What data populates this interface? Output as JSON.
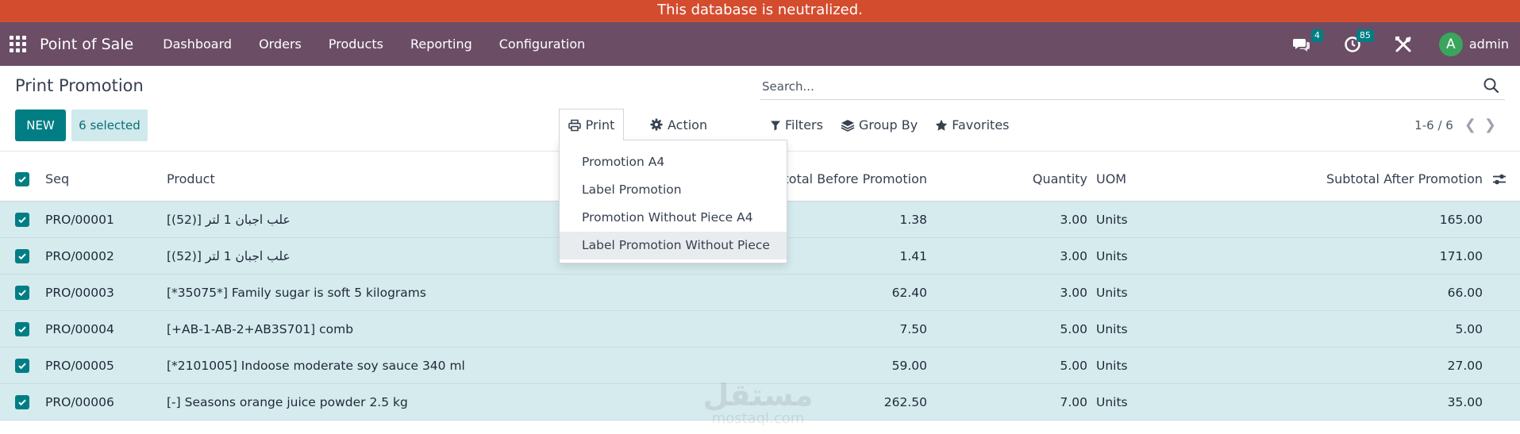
{
  "banner": {
    "text": "This database is neutralized."
  },
  "navbar": {
    "brand": "Point of Sale",
    "menu": [
      "Dashboard",
      "Orders",
      "Products",
      "Reporting",
      "Configuration"
    ],
    "messages_count": "4",
    "activities_count": "85",
    "user_initial": "A",
    "user_name": "admin"
  },
  "page": {
    "title": "Print Promotion"
  },
  "toolbar": {
    "new_label": "NEW",
    "selected_label": "6 selected",
    "print_label": "Print",
    "action_label": "Action"
  },
  "search": {
    "placeholder": "Search..."
  },
  "filters": {
    "filters_label": "Filters",
    "group_by_label": "Group By",
    "favorites_label": "Favorites"
  },
  "pager": {
    "text": "1-6 / 6"
  },
  "print_menu": {
    "items": [
      "Promotion A4",
      "Label Promotion",
      "Promotion Without Piece A4",
      "Label Promotion Without Piece"
    ]
  },
  "table": {
    "headers": {
      "seq": "Seq",
      "product": "Product",
      "subtotal_before": "Subtotal Before Promotion",
      "quantity": "Quantity",
      "uom": "UOM",
      "subtotal_after": "Subtotal After Promotion"
    },
    "rows": [
      {
        "seq": "PRO/00001",
        "product": "علب اجبان 1 لتر [(52)]",
        "before": "1.38",
        "qty": "3.00",
        "uom": "Units",
        "after": "165.00"
      },
      {
        "seq": "PRO/00002",
        "product": "علب اجبان 1 لتر [(52)]",
        "before": "1.41",
        "qty": "3.00",
        "uom": "Units",
        "after": "171.00"
      },
      {
        "seq": "PRO/00003",
        "product": "[*35075*] Family sugar is soft 5 kilograms",
        "before": "62.40",
        "qty": "3.00",
        "uom": "Units",
        "after": "66.00"
      },
      {
        "seq": "PRO/00004",
        "product": "[+AB-1-AB-2+AB3S701] comb",
        "before": "7.50",
        "qty": "5.00",
        "uom": "Units",
        "after": "5.00"
      },
      {
        "seq": "PRO/00005",
        "product": "[*2101005] Indoose moderate soy sauce 340 ml",
        "before": "59.00",
        "qty": "5.00",
        "uom": "Units",
        "after": "27.00"
      },
      {
        "seq": "PRO/00006",
        "product": "[-] Seasons orange juice powder 2.5 kg",
        "before": "262.50",
        "qty": "7.00",
        "uom": "Units",
        "after": "35.00"
      }
    ]
  },
  "watermark": {
    "line1": "مستقل",
    "line2": "mostaql.com"
  }
}
